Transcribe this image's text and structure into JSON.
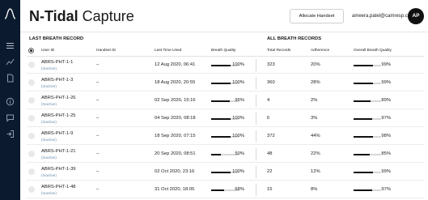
{
  "header": {
    "title_bold": "N-Tidal",
    "title_rest": " Capture",
    "allocate_label": "Allocate Handset",
    "user_email": "ameera.patel@camresp.com",
    "avatar_initials": "AP"
  },
  "sections": {
    "last_breath": "LAST BREATH RECORD",
    "all_breath": "ALL BREATH RECORDS"
  },
  "columns": {
    "user_id": "User ID",
    "handset_id": "Handset ID",
    "last_time_used": "Last Time Used",
    "breath_quality": "Breath Quality",
    "total_records": "Total Records",
    "adherence": "Adherence",
    "overall_quality": "Overall Breath Quality"
  },
  "rows": [
    {
      "user_id": "ABRS-PHT-1-1",
      "status": "(Inactive)",
      "handset_id": "–",
      "last_time": "12 Aug 2020, 06:41",
      "quality": "100%",
      "quality_frac": 1.0,
      "total": "323",
      "adherence": "20%",
      "overall": "99%",
      "overall_frac": 0.99
    },
    {
      "user_id": "ABRS-PHT-1-3",
      "status": "(Inactive)",
      "handset_id": "–",
      "last_time": "18 Aug 2020, 20:55",
      "quality": "100%",
      "quality_frac": 1.0,
      "total": "360",
      "adherence": "28%",
      "overall": "99%",
      "overall_frac": 0.99
    },
    {
      "user_id": "ABRS-PHT-1-26",
      "status": "(Inactive)",
      "handset_id": "–",
      "last_time": "02 Sep 2020, 15:16",
      "quality": "95%",
      "quality_frac": 0.95,
      "total": "4",
      "adherence": "2%",
      "overall": "89%",
      "overall_frac": 0.89
    },
    {
      "user_id": "ABRS-PHT-1-25",
      "status": "(Inactive)",
      "handset_id": "–",
      "last_time": "04 Sep 2020, 08:18",
      "quality": "100%",
      "quality_frac": 1.0,
      "total": "6",
      "adherence": "3%",
      "overall": "97%",
      "overall_frac": 0.97
    },
    {
      "user_id": "ABRS-PHT-1-9",
      "status": "(Inactive)",
      "handset_id": "–",
      "last_time": "18 Sep 2020, 07:15",
      "quality": "100%",
      "quality_frac": 1.0,
      "total": "372",
      "adherence": "44%",
      "overall": "98%",
      "overall_frac": 0.98
    },
    {
      "user_id": "ABRS-PHT-1-21",
      "status": "(Inactive)",
      "handset_id": "–",
      "last_time": "20 Sep 2020, 08:51",
      "quality": "50%",
      "quality_frac": 0.5,
      "total": "48",
      "adherence": "22%",
      "overall": "85%",
      "overall_frac": 0.85
    },
    {
      "user_id": "ABRS-PHT-1-39",
      "status": "(Inactive)",
      "handset_id": "–",
      "last_time": "02 Oct 2020, 23:16",
      "quality": "100%",
      "quality_frac": 1.0,
      "total": "22",
      "adherence": "12%",
      "overall": "99%",
      "overall_frac": 0.99
    },
    {
      "user_id": "ABRS-PHT-1-48",
      "status": "(Inactive)",
      "handset_id": "–",
      "last_time": "31 Oct 2020, 18:05",
      "quality": "68%",
      "quality_frac": 0.68,
      "total": "15",
      "adherence": "8%",
      "overall": "97%",
      "overall_frac": 0.97
    }
  ],
  "icons": [
    "logo-icon",
    "menu-icon",
    "chart-icon",
    "document-icon",
    "info-icon",
    "chat-icon",
    "logout-icon",
    "select-all-icon"
  ],
  "colors": {
    "sidebar_bg": "#0b1a2f",
    "status_inactive": "#6a8fb0",
    "bar_fill": "#111111",
    "bar_track": "#d7d7d7"
  }
}
